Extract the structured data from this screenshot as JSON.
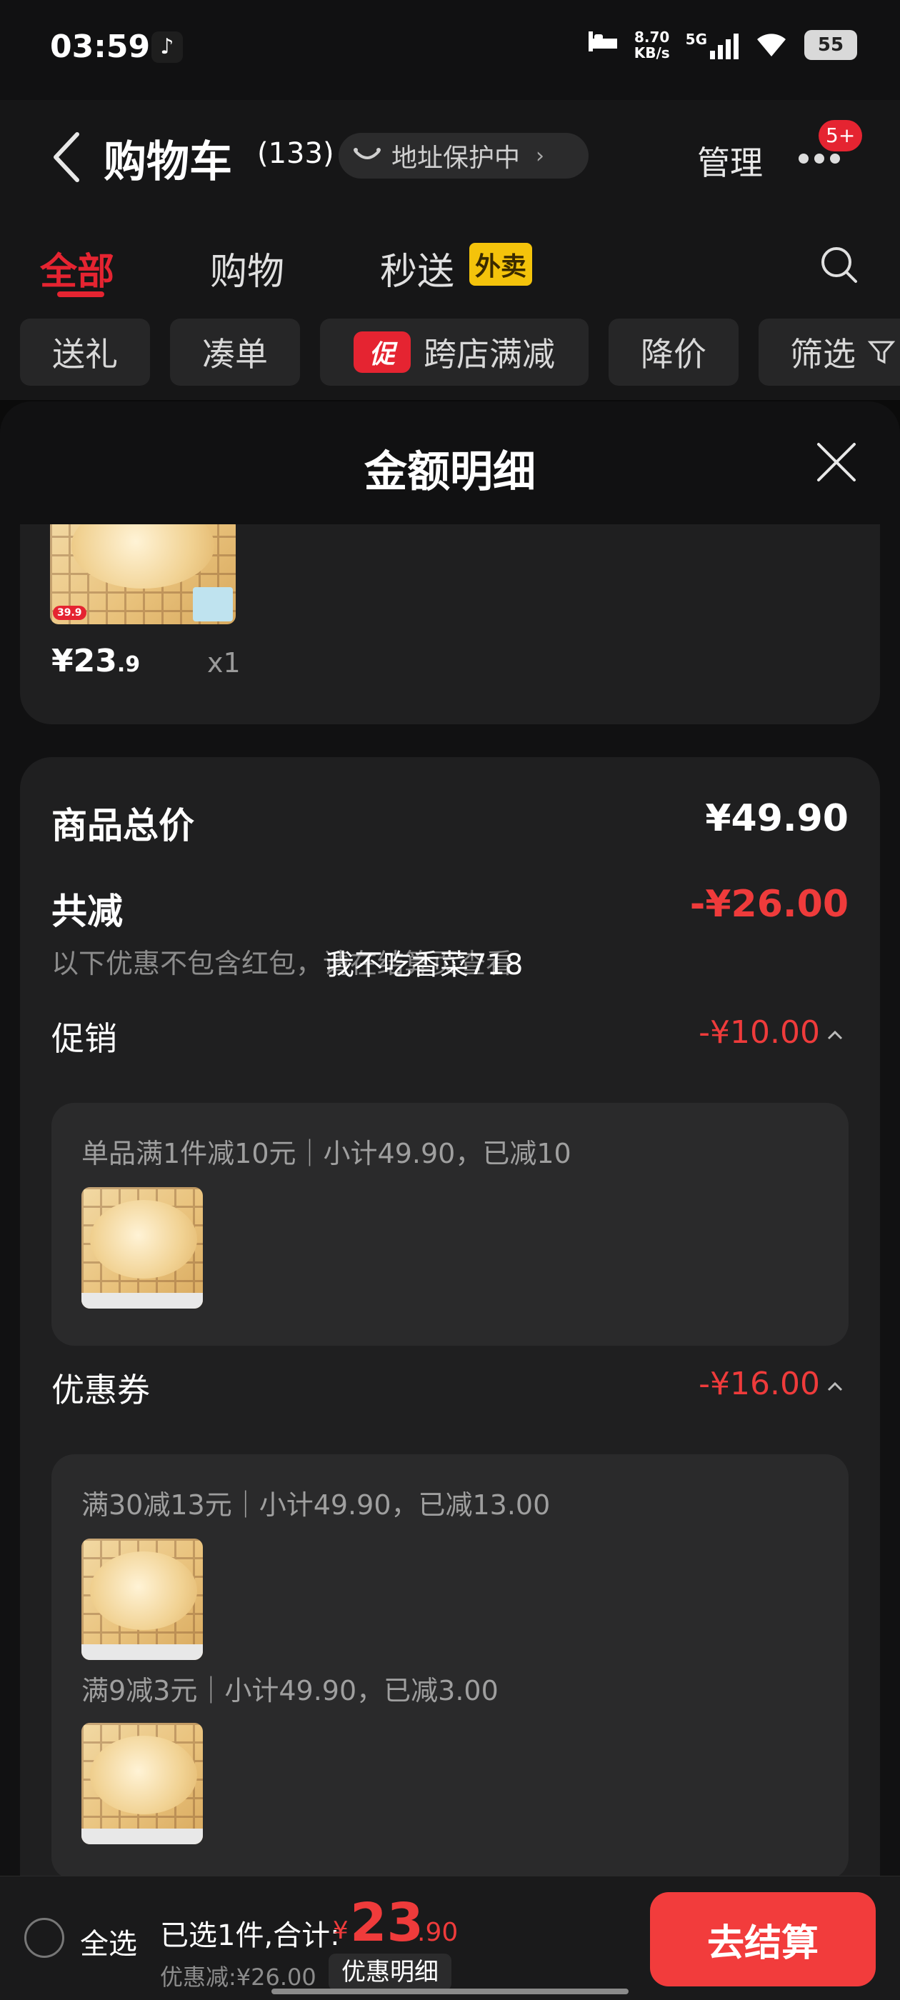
{
  "status_bar": {
    "time": "03:59",
    "net_speed_value": "8.70",
    "net_speed_unit": "KB/s",
    "signal_label": "5G",
    "battery": "55"
  },
  "header": {
    "title": "购物车",
    "count": "(133)",
    "address_protection": "地址保护中",
    "manage": "管理",
    "more_badge": "5+"
  },
  "tabs": [
    {
      "label": "全部",
      "active": true
    },
    {
      "label": "购物",
      "active": false
    },
    {
      "label": "秒送",
      "active": false
    }
  ],
  "waimai_badge": "外卖",
  "filters": [
    {
      "label": "送礼"
    },
    {
      "label": "凑单"
    },
    {
      "label": "跨店满减",
      "badge": "促"
    },
    {
      "label": "降价"
    },
    {
      "label": "筛选"
    }
  ],
  "sheet": {
    "title": "金额明细",
    "top_item": {
      "price_main": "¥23",
      "price_dec": ".9",
      "quantity": "x1",
      "thumb_tag": "39.9"
    },
    "total_label": "商品总价",
    "total_value": "¥49.90",
    "reduced_label": "共减",
    "reduced_value": "-¥26.00",
    "note": "以下优惠不包含红包，请在结算页查看",
    "watermark": "我不吃香菜718",
    "promo": {
      "label": "促销",
      "value": "-¥10.00",
      "lines": [
        "单品满1件减10元｜小计49.90，已减10"
      ]
    },
    "coupon": {
      "label": "优惠券",
      "value": "-¥16.00",
      "lines": [
        "满30减13元｜小计49.90，已减13.00",
        "满9减3元｜小计49.90，已减3.00"
      ]
    }
  },
  "bottom": {
    "select_all": "全选",
    "selected_text": "已选1件,合计:",
    "currency": "¥",
    "total_int": "23",
    "total_dec": ".90",
    "saved_text": "优惠减:¥26.00",
    "detail_button": "优惠明细",
    "checkout": "去结算"
  },
  "colors": {
    "accent_red": "#e52431",
    "price_red": "#ef3b3b",
    "checkout_red": "#f23c3c",
    "waimai_yellow": "#f4c30b",
    "background": "#111112"
  }
}
